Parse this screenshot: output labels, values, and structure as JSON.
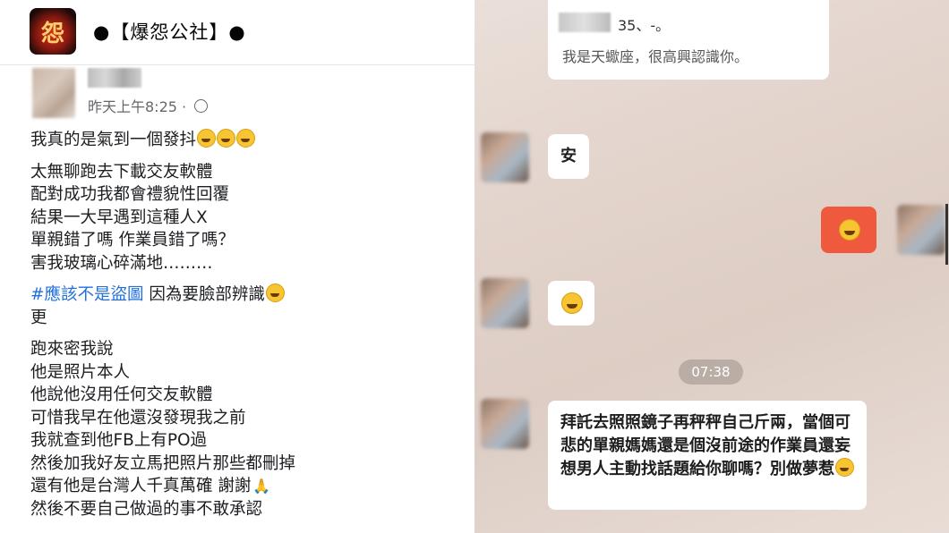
{
  "post": {
    "group_name": "●【爆怨公社】●",
    "timestamp": "昨天上午8:25 · ",
    "lines": [
      "我真的是氣到一個發抖",
      "太無聊跑去下載交友軟體",
      "配對成功我都會禮貌性回覆",
      "結果一大早遇到這種人X",
      "單親錯了嗎 作業員錯了嗎？",
      "害我玻璃心碎滿地………",
      "#應該不是盜圖",
      " 因為要臉部辨識",
      "更",
      "跑來密我說",
      "他是照片本人",
      "他說他沒用任何交友軟體",
      "可惜我早在他還沒發現我之前",
      "我就查到他FB上有PO過",
      "然後加我好友立馬把照片那些都刪掉",
      "還有他是台灣人千真萬確 謝謝",
      "然後不要自己做過的事不敢承認"
    ]
  },
  "chat": {
    "top_card_line1": "35、-。",
    "top_card_line2": "我是天蠍座，很高興認識你。",
    "msg_an": "安",
    "time": "07:38",
    "msg_long": "拜託去照照鏡子再秤秤自己斤兩，當個可悲的單親媽媽還是個沒前途的作業員還妄想男人主動找話題給你聊嗎？別做夢惹"
  },
  "colors": {
    "hashtag": "#216fdb",
    "sent_bubble": "#ef5a3e",
    "emoji": "#f7c531"
  }
}
